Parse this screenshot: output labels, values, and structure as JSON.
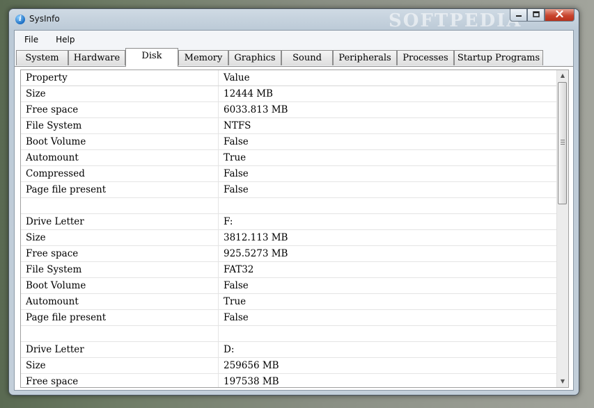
{
  "window": {
    "title": "SysInfo",
    "watermark": "SOFTPEDIA"
  },
  "menu": [
    "File",
    "Help"
  ],
  "tabs": [
    {
      "label": "System",
      "active": false
    },
    {
      "label": "Hardware",
      "active": false
    },
    {
      "label": "Disk",
      "active": true
    },
    {
      "label": "Memory",
      "active": false
    },
    {
      "label": "Graphics",
      "active": false
    },
    {
      "label": "Sound",
      "active": false
    },
    {
      "label": "Peripherals",
      "active": false
    },
    {
      "label": "Processes",
      "active": false
    },
    {
      "label": "Startup Programs",
      "active": false
    }
  ],
  "grid": {
    "columns": {
      "property": "Property",
      "value": "Value"
    },
    "rows": [
      {
        "property": "Size",
        "value": "12444 MB"
      },
      {
        "property": "Free space",
        "value": "6033.813 MB"
      },
      {
        "property": "File System",
        "value": "NTFS"
      },
      {
        "property": "Boot Volume",
        "value": "False"
      },
      {
        "property": "Automount",
        "value": "True"
      },
      {
        "property": "Compressed",
        "value": "False"
      },
      {
        "property": "Page file present",
        "value": "False"
      },
      {
        "property": "",
        "value": ""
      },
      {
        "property": "Drive Letter",
        "value": "F:"
      },
      {
        "property": "Size",
        "value": "3812.113 MB"
      },
      {
        "property": "Free space",
        "value": "925.5273 MB"
      },
      {
        "property": "File System",
        "value": "FAT32"
      },
      {
        "property": "Boot Volume",
        "value": "False"
      },
      {
        "property": "Automount",
        "value": "True"
      },
      {
        "property": "Page file present",
        "value": "False"
      },
      {
        "property": "",
        "value": ""
      },
      {
        "property": "Drive Letter",
        "value": "D:"
      },
      {
        "property": "Size",
        "value": "259656 MB"
      },
      {
        "property": "Free space",
        "value": "197538 MB"
      }
    ]
  },
  "icons": {
    "app": "info-icon",
    "minimize": "minimize-icon",
    "maximize": "maximize-icon",
    "close": "close-icon",
    "scroll_up": "scroll-up-arrow-icon",
    "scroll_down": "scroll-down-arrow-icon"
  }
}
